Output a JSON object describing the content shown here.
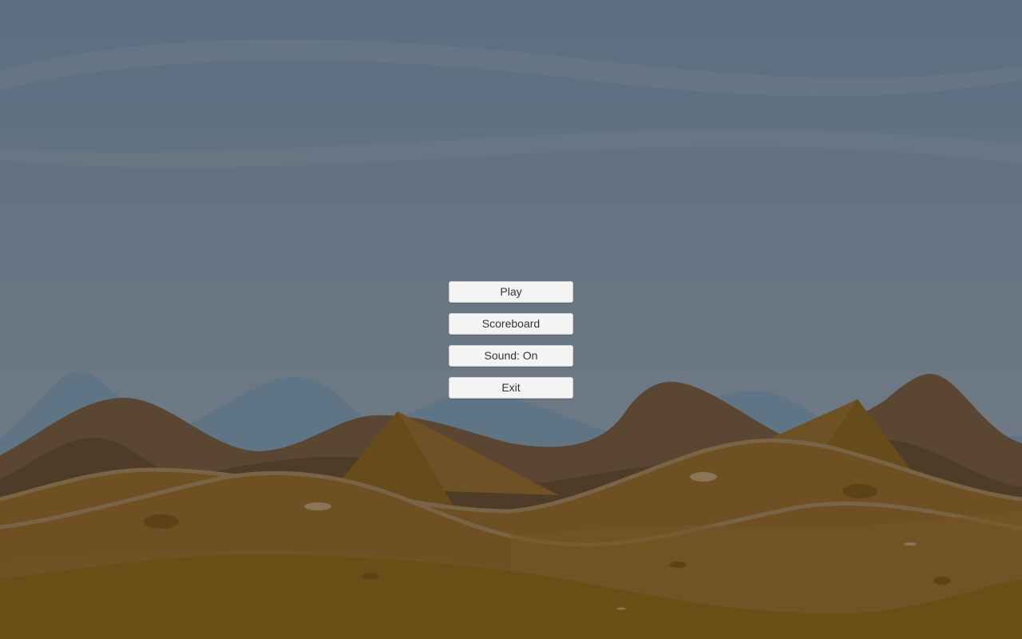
{
  "menu": {
    "buttons": [
      {
        "id": "play",
        "label": "Play"
      },
      {
        "id": "scoreboard",
        "label": "Scoreboard"
      },
      {
        "id": "sound",
        "label": "Sound: On"
      },
      {
        "id": "exit",
        "label": "Exit"
      }
    ]
  },
  "colors": {
    "sky_top": "#5b6e82",
    "sky_bottom": "#717d8a",
    "far_hills": "#5f7485",
    "dark_hills": "#5a4632",
    "pyramid": "#6e5020",
    "sand": "#6e5022",
    "button_bg": "#f4f4f4",
    "button_text": "#333333"
  }
}
